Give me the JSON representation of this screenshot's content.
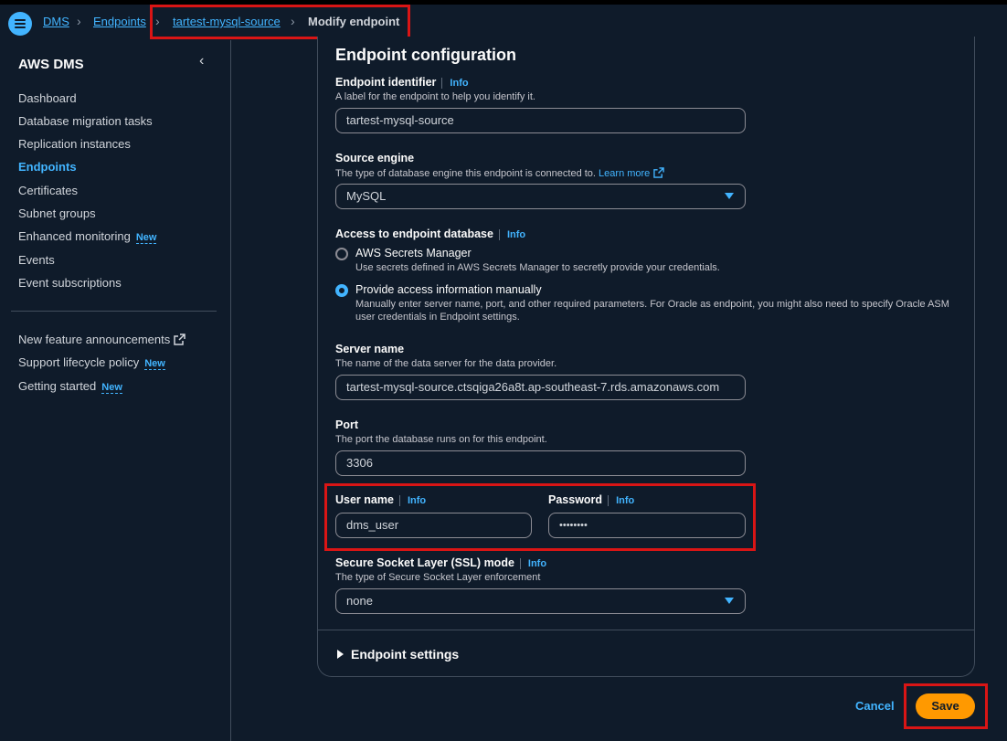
{
  "breadcrumb": {
    "items": [
      "DMS",
      "Endpoints",
      "tartest-mysql-source"
    ],
    "current": "Modify endpoint"
  },
  "sidebar": {
    "title": "AWS DMS",
    "items": [
      {
        "label": "Dashboard"
      },
      {
        "label": "Database migration tasks"
      },
      {
        "label": "Replication instances"
      },
      {
        "label": "Endpoints",
        "active": true
      },
      {
        "label": "Certificates"
      },
      {
        "label": "Subnet groups"
      },
      {
        "label": "Enhanced monitoring",
        "badge": "New"
      },
      {
        "label": "Events"
      },
      {
        "label": "Event subscriptions"
      }
    ],
    "secondary": [
      {
        "label": "New feature announcements",
        "external": true
      },
      {
        "label": "Support lifecycle policy",
        "badge": "New"
      },
      {
        "label": "Getting started",
        "badge": "New"
      }
    ]
  },
  "form": {
    "title": "Endpoint configuration",
    "info_label": "Info",
    "identifier": {
      "label": "Endpoint identifier",
      "description": "A label for the endpoint to help you identify it.",
      "value": "tartest-mysql-source"
    },
    "source_engine": {
      "label": "Source engine",
      "description": "The type of database engine this endpoint is connected to.",
      "learn_more": "Learn more",
      "value": "MySQL"
    },
    "access": {
      "label": "Access to endpoint database",
      "options": [
        {
          "label": "AWS Secrets Manager",
          "description": "Use secrets defined in AWS Secrets Manager to secretly provide your credentials.",
          "checked": false
        },
        {
          "label": "Provide access information manually",
          "description": "Manually enter server name, port, and other required parameters. For Oracle as endpoint, you might also need to specify Oracle ASM user credentials in Endpoint settings.",
          "checked": true
        }
      ]
    },
    "server_name": {
      "label": "Server name",
      "description": "The name of the data server for the data provider.",
      "value": "tartest-mysql-source.ctsqiga26a8t.ap-southeast-7.rds.amazonaws.com"
    },
    "port": {
      "label": "Port",
      "description": "The port the database runs on for this endpoint.",
      "value": "3306"
    },
    "username": {
      "label": "User name",
      "value": "dms_user"
    },
    "password": {
      "label": "Password",
      "value": "••••••••"
    },
    "ssl": {
      "label": "Secure Socket Layer (SSL) mode",
      "description": "The type of Secure Socket Layer enforcement",
      "value": "none"
    },
    "endpoint_settings": "Endpoint settings"
  },
  "footer": {
    "cancel": "Cancel",
    "save": "Save"
  },
  "colors": {
    "background": "#0f1b2a",
    "accent": "#42b4ff",
    "primary_button": "#ff9900",
    "highlight_box": "#d91515"
  }
}
